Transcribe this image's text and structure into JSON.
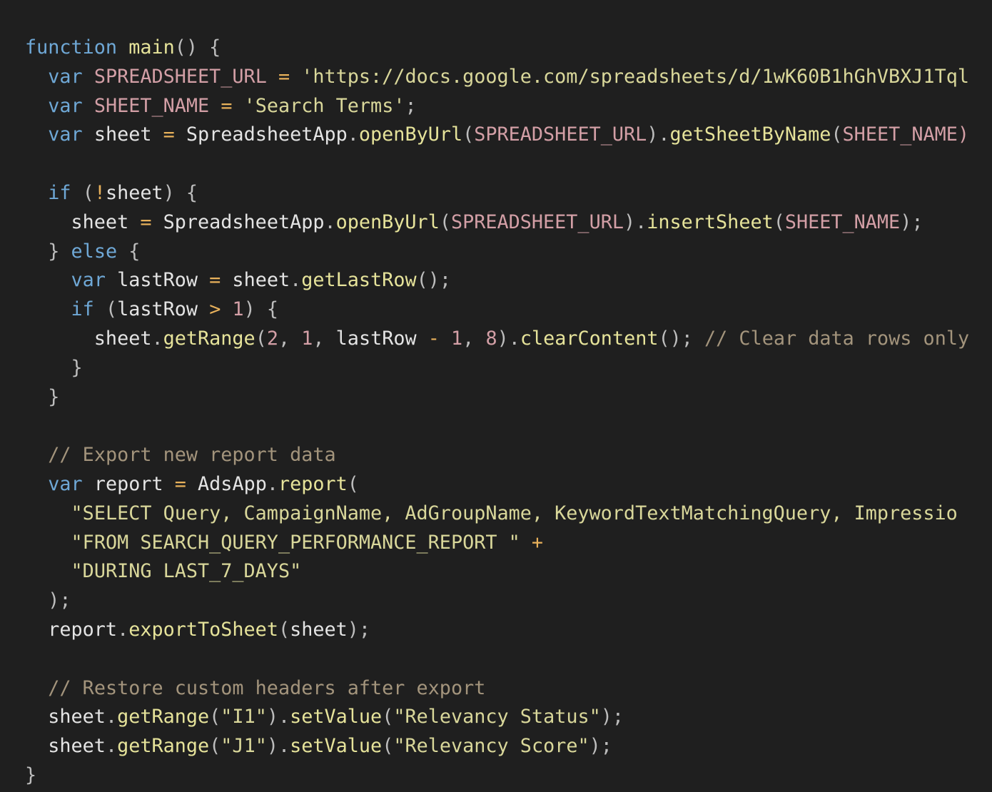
{
  "code_lines": [
    [
      {
        "t": "function",
        "c": "kw"
      },
      {
        "t": " ",
        "c": "pl"
      },
      {
        "t": "main",
        "c": "fn"
      },
      {
        "t": "() {",
        "c": "pu"
      }
    ],
    [
      {
        "t": "  ",
        "c": "pl"
      },
      {
        "t": "var",
        "c": "kw"
      },
      {
        "t": " ",
        "c": "pl"
      },
      {
        "t": "SPREADSHEET_URL",
        "c": "var"
      },
      {
        "t": " ",
        "c": "pl"
      },
      {
        "t": "=",
        "c": "op"
      },
      {
        "t": " ",
        "c": "pl"
      },
      {
        "t": "'https://docs.google.com/spreadsheets/d/1wK60B1hGhVBXJ1Tql",
        "c": "str"
      }
    ],
    [
      {
        "t": "  ",
        "c": "pl"
      },
      {
        "t": "var",
        "c": "kw"
      },
      {
        "t": " ",
        "c": "pl"
      },
      {
        "t": "SHEET_NAME",
        "c": "var"
      },
      {
        "t": " ",
        "c": "pl"
      },
      {
        "t": "=",
        "c": "op"
      },
      {
        "t": " ",
        "c": "pl"
      },
      {
        "t": "'Search Terms'",
        "c": "str"
      },
      {
        "t": ";",
        "c": "pu"
      }
    ],
    [
      {
        "t": "  ",
        "c": "pl"
      },
      {
        "t": "var",
        "c": "kw"
      },
      {
        "t": " sheet ",
        "c": "pl"
      },
      {
        "t": "=",
        "c": "op"
      },
      {
        "t": " SpreadsheetApp",
        "c": "pl"
      },
      {
        "t": ".",
        "c": "pu"
      },
      {
        "t": "openByUrl",
        "c": "fn"
      },
      {
        "t": "(",
        "c": "pu"
      },
      {
        "t": "SPREADSHEET_URL",
        "c": "var"
      },
      {
        "t": ").",
        "c": "pu"
      },
      {
        "t": "getSheetByName",
        "c": "fn"
      },
      {
        "t": "(",
        "c": "pu"
      },
      {
        "t": "SHEET_NAME)",
        "c": "var"
      }
    ],
    [],
    [
      {
        "t": "  ",
        "c": "pl"
      },
      {
        "t": "if",
        "c": "kw"
      },
      {
        "t": " (",
        "c": "pu"
      },
      {
        "t": "!",
        "c": "op"
      },
      {
        "t": "sheet",
        "c": "pl"
      },
      {
        "t": ") {",
        "c": "pu"
      }
    ],
    [
      {
        "t": "    sheet ",
        "c": "pl"
      },
      {
        "t": "=",
        "c": "op"
      },
      {
        "t": " SpreadsheetApp",
        "c": "pl"
      },
      {
        "t": ".",
        "c": "pu"
      },
      {
        "t": "openByUrl",
        "c": "fn"
      },
      {
        "t": "(",
        "c": "pu"
      },
      {
        "t": "SPREADSHEET_URL",
        "c": "var"
      },
      {
        "t": ").",
        "c": "pu"
      },
      {
        "t": "insertSheet",
        "c": "fn"
      },
      {
        "t": "(",
        "c": "pu"
      },
      {
        "t": "SHEET_NAME",
        "c": "var"
      },
      {
        "t": ");",
        "c": "pu"
      }
    ],
    [
      {
        "t": "  } ",
        "c": "pu"
      },
      {
        "t": "else",
        "c": "kw"
      },
      {
        "t": " {",
        "c": "pu"
      }
    ],
    [
      {
        "t": "    ",
        "c": "pl"
      },
      {
        "t": "var",
        "c": "kw"
      },
      {
        "t": " lastRow ",
        "c": "pl"
      },
      {
        "t": "=",
        "c": "op"
      },
      {
        "t": " sheet",
        "c": "pl"
      },
      {
        "t": ".",
        "c": "pu"
      },
      {
        "t": "getLastRow",
        "c": "fn"
      },
      {
        "t": "();",
        "c": "pu"
      }
    ],
    [
      {
        "t": "    ",
        "c": "pl"
      },
      {
        "t": "if",
        "c": "kw"
      },
      {
        "t": " (",
        "c": "pu"
      },
      {
        "t": "lastRow ",
        "c": "pl"
      },
      {
        "t": ">",
        "c": "op"
      },
      {
        "t": " ",
        "c": "pl"
      },
      {
        "t": "1",
        "c": "num"
      },
      {
        "t": ") {",
        "c": "pu"
      }
    ],
    [
      {
        "t": "      sheet",
        "c": "pl"
      },
      {
        "t": ".",
        "c": "pu"
      },
      {
        "t": "getRange",
        "c": "fn"
      },
      {
        "t": "(",
        "c": "pu"
      },
      {
        "t": "2",
        "c": "num"
      },
      {
        "t": ", ",
        "c": "pu"
      },
      {
        "t": "1",
        "c": "num"
      },
      {
        "t": ", ",
        "c": "pu"
      },
      {
        "t": "lastRow ",
        "c": "pl"
      },
      {
        "t": "-",
        "c": "op"
      },
      {
        "t": " ",
        "c": "pl"
      },
      {
        "t": "1",
        "c": "num"
      },
      {
        "t": ", ",
        "c": "pu"
      },
      {
        "t": "8",
        "c": "num"
      },
      {
        "t": ").",
        "c": "pu"
      },
      {
        "t": "clearContent",
        "c": "fn"
      },
      {
        "t": "(); ",
        "c": "pu"
      },
      {
        "t": "// Clear data rows only",
        "c": "cmt"
      }
    ],
    [
      {
        "t": "    }",
        "c": "pu"
      }
    ],
    [
      {
        "t": "  }",
        "c": "pu"
      }
    ],
    [],
    [
      {
        "t": "  ",
        "c": "pl"
      },
      {
        "t": "// Export new report data",
        "c": "cmt"
      }
    ],
    [
      {
        "t": "  ",
        "c": "pl"
      },
      {
        "t": "var",
        "c": "kw"
      },
      {
        "t": " report ",
        "c": "pl"
      },
      {
        "t": "=",
        "c": "op"
      },
      {
        "t": " AdsApp",
        "c": "pl"
      },
      {
        "t": ".",
        "c": "pu"
      },
      {
        "t": "report",
        "c": "fn"
      },
      {
        "t": "(",
        "c": "pu"
      }
    ],
    [
      {
        "t": "    ",
        "c": "pl"
      },
      {
        "t": "\"SELECT Query, CampaignName, AdGroupName, KeywordTextMatchingQuery, Impressio",
        "c": "str"
      }
    ],
    [
      {
        "t": "    ",
        "c": "pl"
      },
      {
        "t": "\"FROM SEARCH_QUERY_PERFORMANCE_REPORT \"",
        "c": "str"
      },
      {
        "t": " ",
        "c": "pl"
      },
      {
        "t": "+",
        "c": "op"
      }
    ],
    [
      {
        "t": "    ",
        "c": "pl"
      },
      {
        "t": "\"DURING LAST_7_DAYS\"",
        "c": "str"
      }
    ],
    [
      {
        "t": "  );",
        "c": "pu"
      }
    ],
    [
      {
        "t": "  report",
        "c": "pl"
      },
      {
        "t": ".",
        "c": "pu"
      },
      {
        "t": "exportToSheet",
        "c": "fn"
      },
      {
        "t": "(",
        "c": "pu"
      },
      {
        "t": "sheet",
        "c": "pl"
      },
      {
        "t": ");",
        "c": "pu"
      }
    ],
    [],
    [
      {
        "t": "  ",
        "c": "pl"
      },
      {
        "t": "// Restore custom headers after export",
        "c": "cmt"
      }
    ],
    [
      {
        "t": "  sheet",
        "c": "pl"
      },
      {
        "t": ".",
        "c": "pu"
      },
      {
        "t": "getRange",
        "c": "fn"
      },
      {
        "t": "(",
        "c": "pu"
      },
      {
        "t": "\"I1\"",
        "c": "str"
      },
      {
        "t": ").",
        "c": "pu"
      },
      {
        "t": "setValue",
        "c": "fn"
      },
      {
        "t": "(",
        "c": "pu"
      },
      {
        "t": "\"Relevancy Status\"",
        "c": "str"
      },
      {
        "t": ");",
        "c": "pu"
      }
    ],
    [
      {
        "t": "  sheet",
        "c": "pl"
      },
      {
        "t": ".",
        "c": "pu"
      },
      {
        "t": "getRange",
        "c": "fn"
      },
      {
        "t": "(",
        "c": "pu"
      },
      {
        "t": "\"J1\"",
        "c": "str"
      },
      {
        "t": ").",
        "c": "pu"
      },
      {
        "t": "setValue",
        "c": "fn"
      },
      {
        "t": "(",
        "c": "pu"
      },
      {
        "t": "\"Relevancy Score\"",
        "c": "str"
      },
      {
        "t": ");",
        "c": "pu"
      }
    ],
    [
      {
        "t": "}",
        "c": "pu"
      }
    ]
  ]
}
